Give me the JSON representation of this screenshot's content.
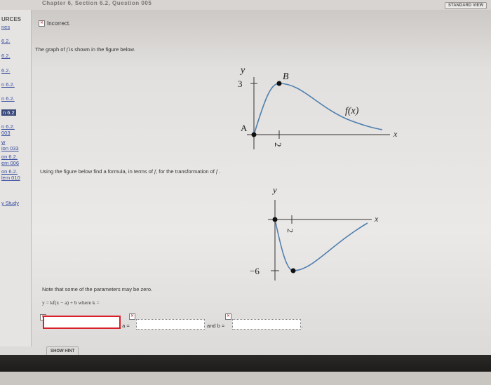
{
  "header": {
    "chapter_title": "Chapter 6, Section 6.2, Question 005",
    "view_button": "STANDARD VIEW"
  },
  "sidebar": {
    "heading": "URCES",
    "subheading": "nes",
    "items": [
      "6.2.",
      "6.2.",
      "6.2.",
      "n 6.2.",
      "n 6.2.",
      "n 6.2",
      "n 6.2.",
      "003",
      "w",
      "ion 033",
      "on 6.2.",
      "em 006",
      "on 6.2.",
      "lem 010",
      "y Study"
    ]
  },
  "feedback": {
    "status": "Incorrect."
  },
  "problem": {
    "intro_prefix": "The graph of ",
    "intro_fn": "f",
    "intro_suffix": " is shown in the figure below.",
    "question_prefix": "Using the figure below find a formula, in terms of ",
    "question_fn": "f",
    "question_mid": ", for the transformation of ",
    "question_fn2": "f",
    "question_suffix": " .",
    "note": "Note that some of the parameters may be zero.",
    "formula": "y = kf(x − a) + b where k ="
  },
  "figure1": {
    "y_label": "y",
    "x_label": "x",
    "tick_y": "3",
    "tick_x": "2",
    "point_a": "A",
    "point_b": "B",
    "curve_label": "f(x)"
  },
  "figure2": {
    "y_label": "y",
    "x_label": "x",
    "tick_y": "−6",
    "tick_x": "2"
  },
  "answers": {
    "k_value": "",
    "a_label": ", a =",
    "a_value": "",
    "b_label": "and b =",
    "b_value": "",
    "end_punct": "."
  },
  "buttons": {
    "show_hint": "SHOW HINT"
  },
  "icons": {
    "incorrect_mark": "✕"
  }
}
